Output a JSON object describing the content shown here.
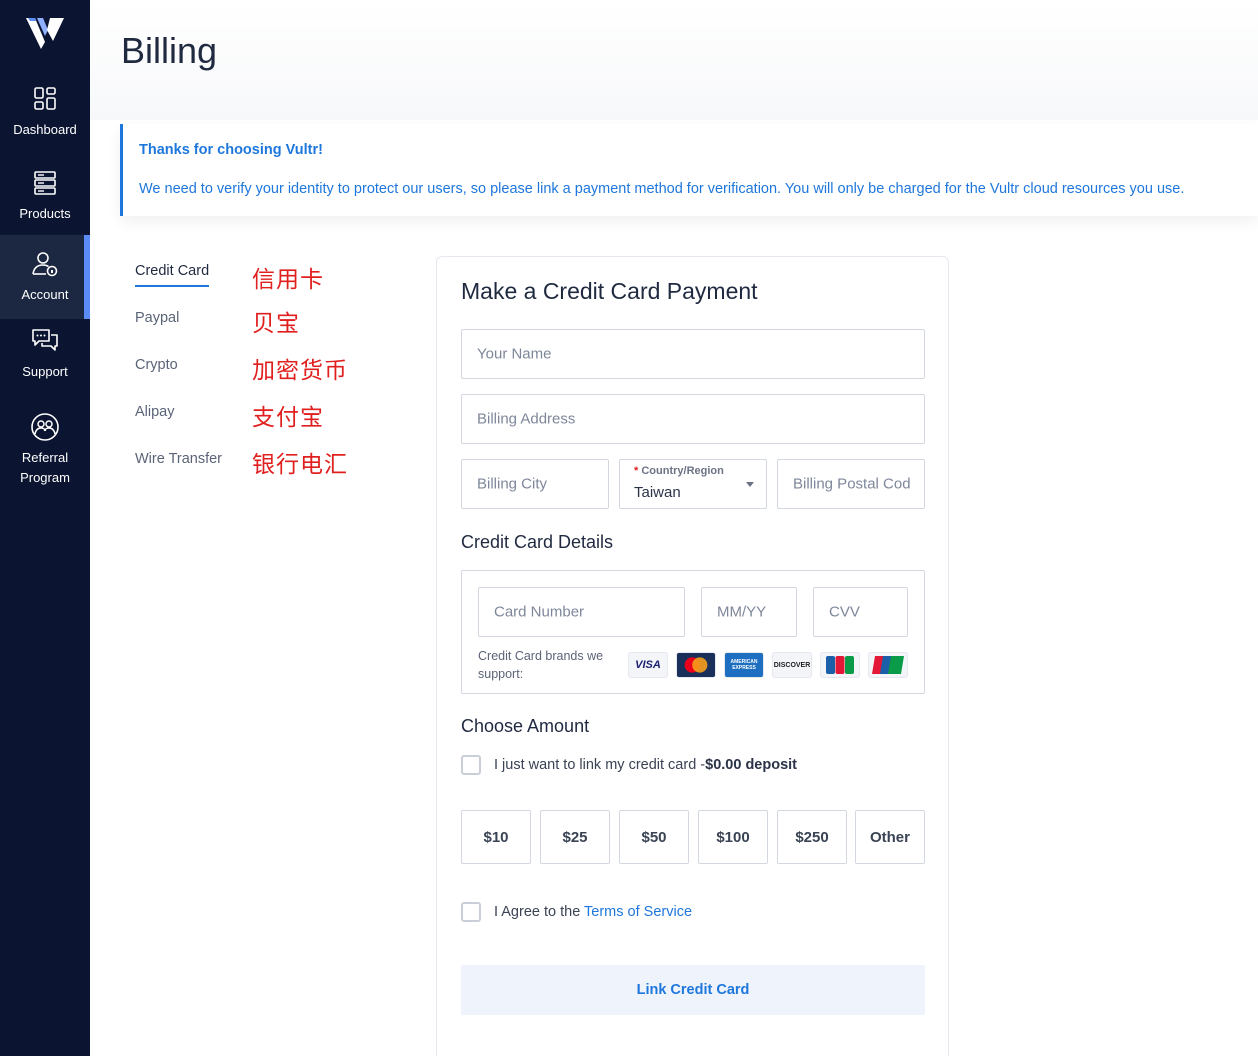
{
  "sidebar": {
    "logo_icon": "vultr-logo-icon",
    "items": [
      {
        "label": "Dashboard",
        "icon": "dashboard-grid-icon",
        "active": false
      },
      {
        "label": "Products",
        "icon": "server-stack-icon",
        "active": false
      },
      {
        "label": "Account",
        "icon": "user-lock-icon",
        "active": true
      },
      {
        "label": "Support",
        "icon": "chat-bubbles-icon",
        "active": false
      },
      {
        "label_line1": "Referral",
        "label_line2": "Program",
        "icon": "referral-people-icon",
        "active": false
      }
    ]
  },
  "page": {
    "title": "Billing"
  },
  "banner": {
    "title": "Thanks for choosing Vultr!",
    "text": "We need to verify your identity to protect our users, so please link a payment method for verification. You will only be charged for the Vultr cloud resources you use."
  },
  "methods": [
    {
      "label": "Credit Card",
      "annotation": "信用卡",
      "active": true
    },
    {
      "label": "Paypal",
      "annotation": "贝宝",
      "active": false
    },
    {
      "label": "Crypto",
      "annotation": "加密货币",
      "active": false
    },
    {
      "label": "Alipay",
      "annotation": "支付宝",
      "active": false
    },
    {
      "label": "Wire Transfer",
      "annotation": "银行电汇",
      "active": false
    }
  ],
  "form": {
    "title": "Make a Credit Card Payment",
    "name_placeholder": "Your Name",
    "address_placeholder": "Billing Address",
    "city_placeholder": "Billing City",
    "country_label": "Country/Region",
    "country_required_mark": "*",
    "country_value": "Taiwan",
    "postal_placeholder": "Billing Postal Cod",
    "card_details_title": "Credit Card Details",
    "card_number_placeholder": "Card Number",
    "expiry_placeholder": "MM/YY",
    "cvv_placeholder": "CVV",
    "brands_label": "Credit Card brands we support:",
    "brands": [
      {
        "name": "VISA",
        "icon": "visa-icon",
        "bg": "#f4f5f8",
        "fg": "#1a1f71"
      },
      {
        "name": "MasterCard",
        "icon": "mastercard-icon",
        "bg": "#1a2f5a",
        "fg": "#ffffff"
      },
      {
        "name": "AMERICAN EXPRESS",
        "icon": "amex-icon",
        "bg": "#1e6fc2",
        "fg": "#ffffff"
      },
      {
        "name": "DISCOVER",
        "icon": "discover-icon",
        "bg": "#f4f5f8",
        "fg": "#222222"
      },
      {
        "name": "JCB",
        "icon": "jcb-icon",
        "bg": "#f4f5f8",
        "fg": "#1a5fa8"
      },
      {
        "name": "UnionPay",
        "icon": "unionpay-icon",
        "bg": "#e21836",
        "fg": "#ffffff"
      }
    ],
    "amount_title": "Choose Amount",
    "link_only_text": "I just want to link my credit card -",
    "link_only_bold": "$0.00 deposit",
    "amounts": [
      "$10",
      "$25",
      "$50",
      "$100",
      "$250",
      "Other"
    ],
    "agree_text": "I Agree to the ",
    "tos_link": "Terms of Service",
    "submit_label": "Link Credit Card"
  },
  "colors": {
    "sidebar_bg": "#0b1430",
    "accent": "#1e77dc",
    "annotation_red": "#e0201f"
  }
}
